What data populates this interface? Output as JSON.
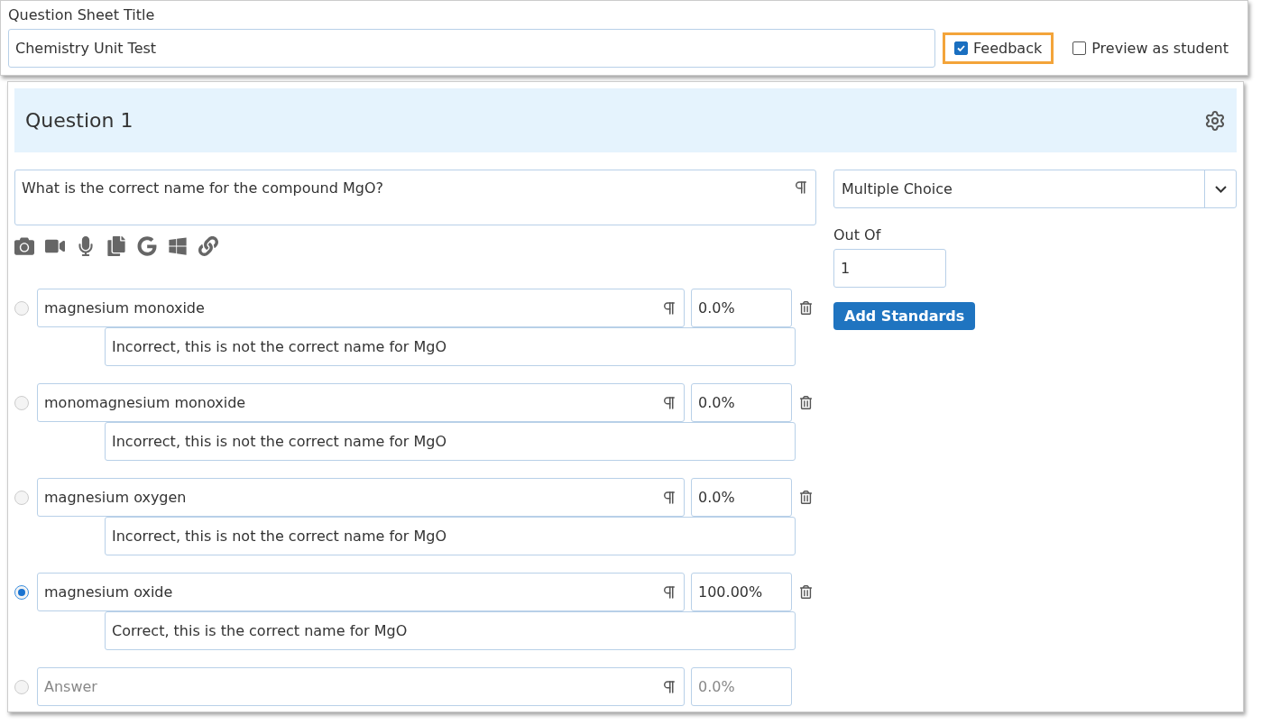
{
  "sheet": {
    "label": "Question Sheet Title",
    "title": "Chemistry Unit Test"
  },
  "options": [
    {
      "label": "Feedback",
      "checked": true,
      "highlighted": true
    },
    {
      "label": "Preview as student",
      "checked": false,
      "highlighted": false
    }
  ],
  "question": {
    "heading": "Question 1",
    "prompt": "What is the correct name for the compound MgO?",
    "type": "Multiple Choice",
    "out_of_label": "Out Of",
    "out_of": "1",
    "add_button": "Add Standards",
    "choices": [
      {
        "answer": "magnesium monoxide",
        "score": "0.0%",
        "feedback": "Incorrect, this is not the correct name for MgO",
        "selected": false
      },
      {
        "answer": "monomagnesium monoxide",
        "score": "0.0%",
        "feedback": "Incorrect, this is not the correct name for MgO",
        "selected": false
      },
      {
        "answer": "magnesium oxygen",
        "score": "0.0%",
        "feedback": "Incorrect, this is not the correct name for MgO",
        "selected": false
      },
      {
        "answer": "magnesium oxide",
        "score": "100.00%",
        "feedback": "Correct, this is the correct name for MgO",
        "selected": true
      },
      {
        "answer_placeholder": "Answer",
        "score_placeholder": "0.0%",
        "selected": false
      }
    ]
  }
}
